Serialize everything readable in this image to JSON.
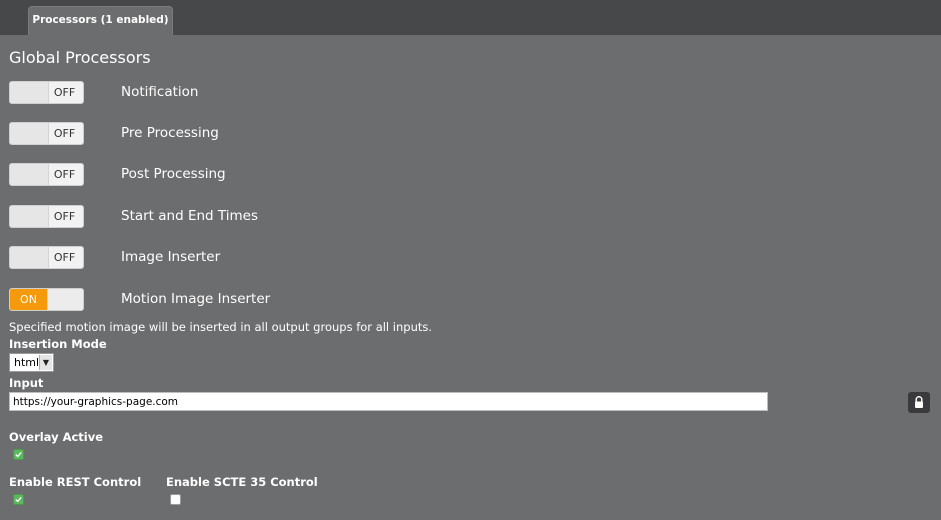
{
  "tabs": [
    {
      "label": "Processors (1 enabled)"
    }
  ],
  "section": {
    "title": "Global Processors"
  },
  "processors": [
    {
      "label": "Notification",
      "state": "OFF"
    },
    {
      "label": "Pre Processing",
      "state": "OFF"
    },
    {
      "label": "Post Processing",
      "state": "OFF"
    },
    {
      "label": "Start and End Times",
      "state": "OFF"
    },
    {
      "label": "Image Inserter",
      "state": "OFF"
    },
    {
      "label": "Motion Image Inserter",
      "state": "ON"
    }
  ],
  "motion_image": {
    "description": "Specified motion image will be inserted in all output groups for all inputs.",
    "insertion_mode_label": "Insertion Mode",
    "insertion_mode_value": "html",
    "input_label": "Input",
    "input_value": "https://your-graphics-page.com",
    "overlay_active_label": "Overlay Active",
    "overlay_active": true,
    "rest_control_label": "Enable REST Control",
    "rest_control": true,
    "scte35_label": "Enable SCTE 35 Control",
    "scte35": false
  },
  "icons": {
    "lock": "lock-icon",
    "dropdown": "chevron-down-icon",
    "check": "checkmark-icon"
  },
  "colors": {
    "background": "#6c6d6f",
    "tabbar": "#474849",
    "toggle_on": "#f59a0c",
    "checkbox_checked": "#5cb85c"
  }
}
